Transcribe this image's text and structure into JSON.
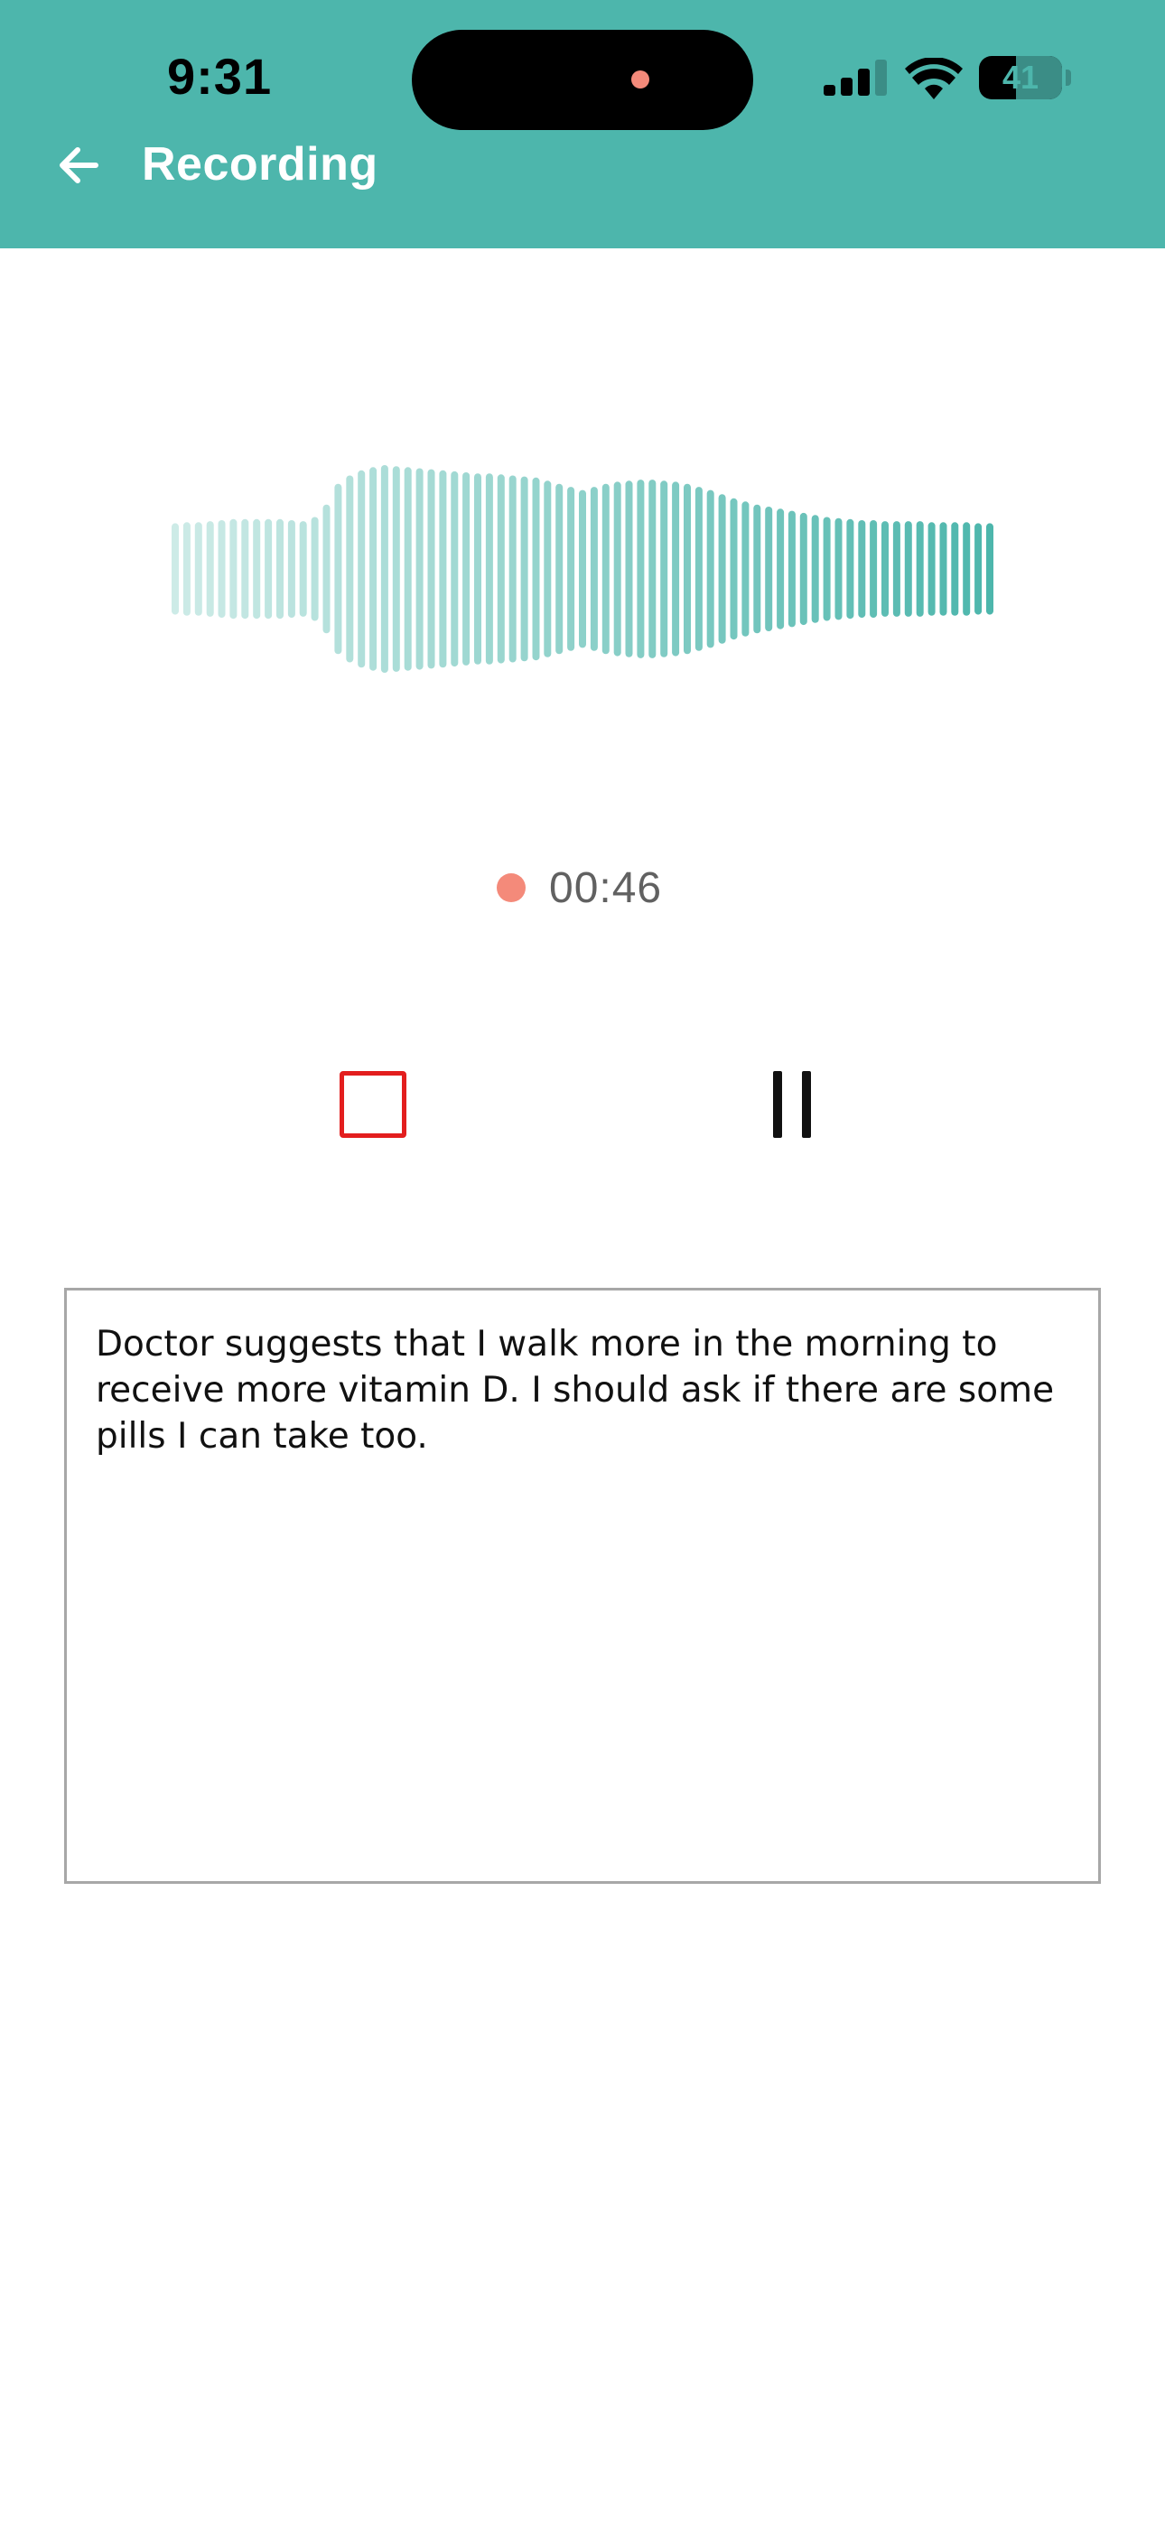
{
  "status_bar": {
    "time": "9:31",
    "battery": "41"
  },
  "header": {
    "title": "Recording"
  },
  "recorder": {
    "elapsed": "00:46",
    "waveform_levels": [
      0.44,
      0.45,
      0.45,
      0.46,
      0.47,
      0.48,
      0.48,
      0.48,
      0.48,
      0.48,
      0.47,
      0.46,
      0.5,
      0.62,
      0.82,
      0.9,
      0.95,
      0.98,
      1.0,
      0.99,
      0.98,
      0.97,
      0.96,
      0.95,
      0.94,
      0.93,
      0.92,
      0.92,
      0.91,
      0.9,
      0.89,
      0.88,
      0.85,
      0.82,
      0.79,
      0.76,
      0.79,
      0.82,
      0.84,
      0.85,
      0.86,
      0.86,
      0.85,
      0.84,
      0.82,
      0.79,
      0.76,
      0.72,
      0.68,
      0.65,
      0.62,
      0.6,
      0.58,
      0.56,
      0.54,
      0.52,
      0.5,
      0.49,
      0.48,
      0.47,
      0.47,
      0.46,
      0.46,
      0.46,
      0.46,
      0.45,
      0.45,
      0.45,
      0.45,
      0.44,
      0.44
    ],
    "color_start": "#cdebe7",
    "color_end": "#4db6ac",
    "stop_color": "#e31e1e",
    "rec_color": "#f48a7a"
  },
  "notes": {
    "text": "Doctor suggests that I walk more in the morning to receive more vitamin D. I should ask if there are some pills I can take too."
  }
}
